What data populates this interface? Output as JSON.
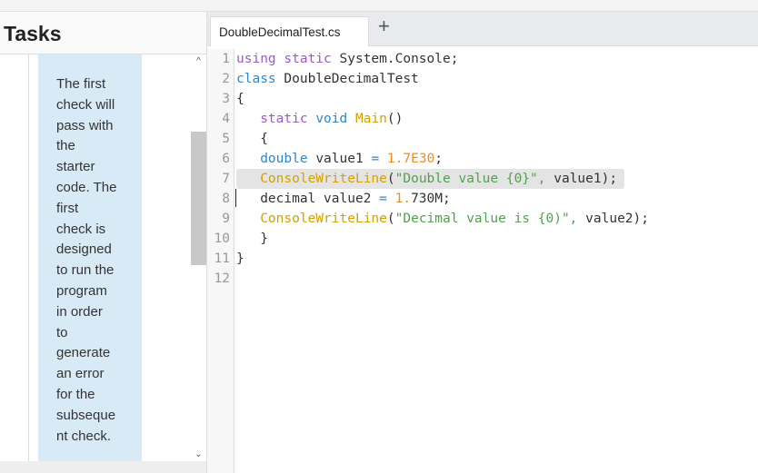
{
  "tasks_panel": {
    "title": "Tasks",
    "note_lines": [
      "The first",
      "check will",
      "pass with",
      "the",
      "starter",
      "code. The",
      "first",
      "check is",
      "designed",
      "to run the",
      "program",
      "in order",
      "to",
      "generate",
      "an error",
      "for the",
      "subseque",
      "nt check."
    ]
  },
  "editor": {
    "tab_label": "DoubleDecimalTest.cs",
    "add_tab_label": "+",
    "line_numbers": [
      "1",
      "2",
      "3",
      "4",
      "5",
      "6",
      "7",
      "8",
      "9",
      "10",
      "11",
      "12"
    ],
    "highlighted_line": 7,
    "lines": [
      [
        [
          "kw",
          "using"
        ],
        [
          "tx",
          " "
        ],
        [
          "kw",
          "static"
        ],
        [
          "tx",
          " System.Console;"
        ]
      ],
      [
        [
          "ty",
          "class"
        ],
        [
          "tx",
          " DoubleDecimalTest"
        ]
      ],
      [
        [
          "tx",
          "{"
        ]
      ],
      [
        [
          "tx",
          "   "
        ],
        [
          "kw",
          "static"
        ],
        [
          "tx",
          " "
        ],
        [
          "ty",
          "void"
        ],
        [
          "tx",
          " "
        ],
        [
          "fn",
          "Main"
        ],
        [
          "tx",
          "()"
        ]
      ],
      [
        [
          "tx",
          "   {"
        ]
      ],
      [
        [
          "tx",
          "   "
        ],
        [
          "ty",
          "double"
        ],
        [
          "tx",
          " value1 "
        ],
        [
          "op",
          "="
        ],
        [
          "tx",
          " "
        ],
        [
          "num",
          "1.7E30"
        ],
        [
          "tx",
          ";"
        ]
      ],
      [
        [
          "tx",
          "   "
        ],
        [
          "fn",
          "ConsoleWriteLine"
        ],
        [
          "tx",
          "("
        ],
        [
          "str",
          "\"Double value {0}\","
        ],
        [
          "tx",
          " value1);"
        ]
      ],
      [
        [
          "tx",
          "   decimal value2 "
        ],
        [
          "op",
          "="
        ],
        [
          "tx",
          " "
        ],
        [
          "num",
          "1."
        ],
        [
          "tx",
          "730M;"
        ]
      ],
      [
        [
          "tx",
          "   "
        ],
        [
          "fn",
          "ConsoleWriteLine"
        ],
        [
          "tx",
          "("
        ],
        [
          "str",
          "\"Decimal value is {0)\","
        ],
        [
          "tx",
          " value2);"
        ]
      ],
      [
        [
          "tx",
          "   }"
        ]
      ],
      [
        [
          "tx",
          "}"
        ]
      ],
      [
        [
          "tx",
          ""
        ]
      ]
    ]
  }
}
